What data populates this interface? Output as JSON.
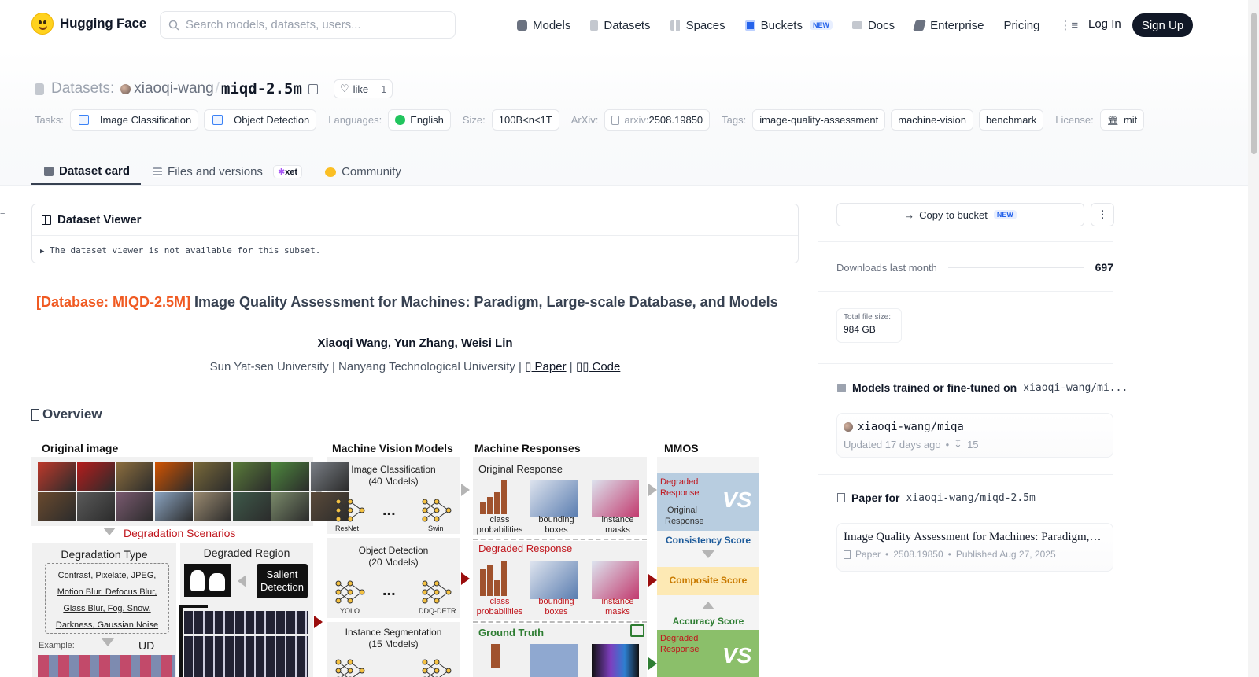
{
  "nav": {
    "brand": "Hugging Face",
    "search_placeholder": "Search models, datasets, users...",
    "items": [
      {
        "label": "Models",
        "icon": "cube-icon",
        "color": "#6b7280"
      },
      {
        "label": "Datasets",
        "icon": "database-icon",
        "color": "#9ca3af"
      },
      {
        "label": "Spaces",
        "icon": "grid-icon",
        "color": "#9ca3af"
      },
      {
        "label": "Buckets",
        "icon": "bucket-icon",
        "color": "#2563eb",
        "badge": "NEW"
      },
      {
        "label": "Docs",
        "icon": "book-icon",
        "color": "#9ca3af"
      },
      {
        "label": "Enterprise",
        "icon": "briefcase-icon",
        "color": "#6b7280"
      },
      {
        "label": "Pricing"
      }
    ],
    "more_icon": "menu-icon",
    "login": "Log In",
    "signup": "Sign Up"
  },
  "repo": {
    "type_label": "Datasets:",
    "owner": "xiaoqi-wang",
    "separator": "/",
    "name": "miqd-2.5m",
    "like_label": "like",
    "like_count": "1"
  },
  "tags": {
    "tasks_label": "Tasks:",
    "tasks": [
      "Image Classification",
      "Object Detection"
    ],
    "languages_label": "Languages:",
    "language": "English",
    "size_label": "Size:",
    "size": "100B<n<1T",
    "arxiv_label": "ArXiv:",
    "arxiv_prefix": "arxiv:",
    "arxiv_id": "2508.19850",
    "tags_label": "Tags:",
    "tag_list": [
      "image-quality-assessment",
      "machine-vision",
      "benchmark"
    ],
    "license_label": "License:",
    "license": "mit"
  },
  "tabs": [
    {
      "label": "Dataset card",
      "active": true
    },
    {
      "label": "Files and versions",
      "badge": "xet"
    },
    {
      "label": "Community"
    }
  ],
  "viewer": {
    "title": "Dataset Viewer",
    "message": "The dataset viewer is not available for this subset."
  },
  "card": {
    "title_accent": "[Database: MIQD-2.5M]",
    "title_rest": " Image Quality Assessment for Machines: Paradigm, Large-scale Database, and Models",
    "authors": "Xiaoqi Wang, Yun Zhang, Weisi Lin",
    "affiliation": "Sun Yat-sen University | Nanyang Technological University | ",
    "paper_link": "▯ Paper",
    "pipe": " | ",
    "code_link": "▯▯ Code",
    "overview": "Overview"
  },
  "figure": {
    "col_original": "Original image",
    "col_models": "Machine Vision Models",
    "col_responses": "Machine Responses",
    "col_mmos": "MMOS",
    "degradation_scenarios": "Degradation Scenarios",
    "degradation_type": "Degradation Type",
    "degraded_region": "Degraded Region",
    "deg_types_1": "Contrast, Pixelate, JPEG,",
    "deg_types_2": "Motion Blur, Defocus Blur,",
    "deg_types_3": "Glass Blur, Fog, Snow,",
    "deg_types_4": "Darkness, Gaussian Noise",
    "salient_1": "Salient",
    "salient_2": "Detection",
    "example": "Example:",
    "ud": "UD",
    "img_cls": "Image Classification",
    "img_cls_n": "(40 Models)",
    "obj_det": "Object Detection",
    "obj_det_n": "(20 Models)",
    "inst_seg": "Instance Segmentation",
    "inst_seg_n": "(15 Models)",
    "ellipsis": "...",
    "resnet": "ResNet",
    "swin": "Swin",
    "yolo": "YOLO",
    "ddq": "DDQ-DETR",
    "original_response": "Original Response",
    "degraded_response": "Degraded Response",
    "ground_truth": "Ground Truth",
    "class_prob_1": "class",
    "class_prob_2": "probabilities",
    "bbox_1": "bounding",
    "bbox_2": "boxes",
    "inst_1": "instance",
    "inst_2": "masks",
    "mmos_degraded": "Degraded",
    "mmos_response": "Response",
    "mmos_original": "Original",
    "vs": "VS",
    "consistency": "Consistency Score",
    "composite": "Composite Score",
    "accuracy": "Accuracy Score"
  },
  "sidebar": {
    "copy_bucket": "Copy to bucket",
    "copy_badge": "NEW",
    "kebab": "⋮",
    "downloads_label": "Downloads last month",
    "downloads_value": "697",
    "filesize_label": "Total file size:",
    "filesize_value": "984 GB",
    "models_head": "Models trained or fine-tuned on",
    "models_repo": "xiaoqi-wang/mi...",
    "model_name": "xiaoqi-wang/miqa",
    "model_updated": "Updated 17 days ago",
    "model_downloads": "15",
    "paper_head": "Paper for",
    "paper_repo": "xiaoqi-wang/miqd-2.5m",
    "paper_title": "Image Quality Assessment for Machines: Paradigm, Large-scale Database, and Models",
    "paper_kind": "Paper",
    "paper_id": "2508.19850",
    "paper_published": "Published Aug 27, 2025"
  }
}
